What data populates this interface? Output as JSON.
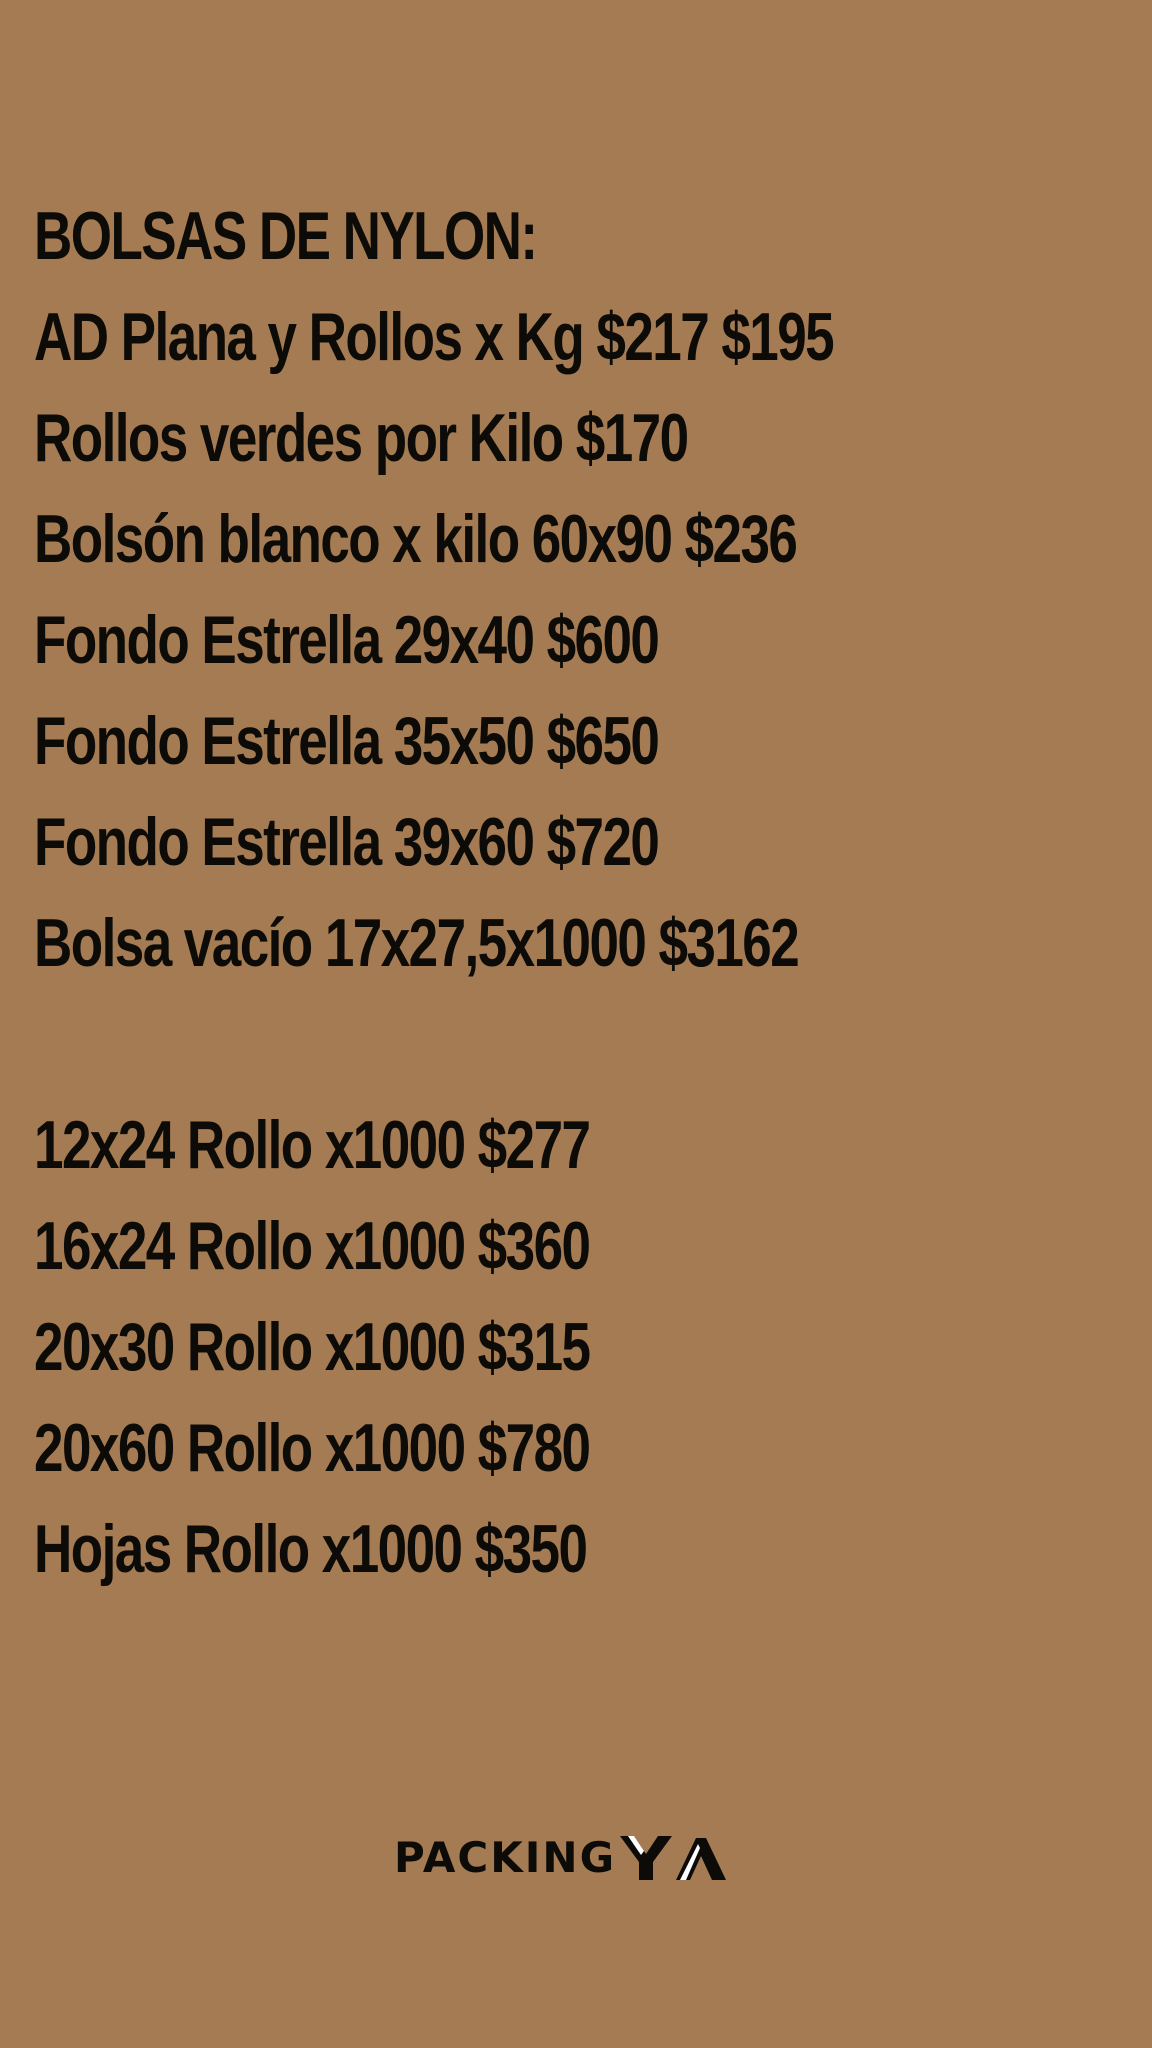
{
  "section_1": {
    "heading": "BOLSAS DE NYLON:",
    "items": [
      "AD Plana y Rollos x Kg $217 $195",
      "Rollos verdes por Kilo $170",
      "Bolsón blanco x kilo 60x90 $236",
      "Fondo Estrella 29x40 $600",
      "Fondo Estrella 35x50 $650",
      "Fondo Estrella 39x60 $720",
      "Bolsa vacío 17x27,5x1000 $3162"
    ]
  },
  "section_2": {
    "items": [
      "12x24 Rollo x1000 $277",
      "16x24 Rollo x1000 $360",
      "20x30 Rollo x1000 $315",
      "20x60 Rollo x1000 $780",
      "Hojas Rollo x1000 $350"
    ]
  },
  "logo": {
    "text": "PACKING",
    "mark_letters": "YA"
  },
  "colors": {
    "background": "#a47b53",
    "text": "#0d0b08",
    "logo_mark_accent": "#ffffff"
  }
}
